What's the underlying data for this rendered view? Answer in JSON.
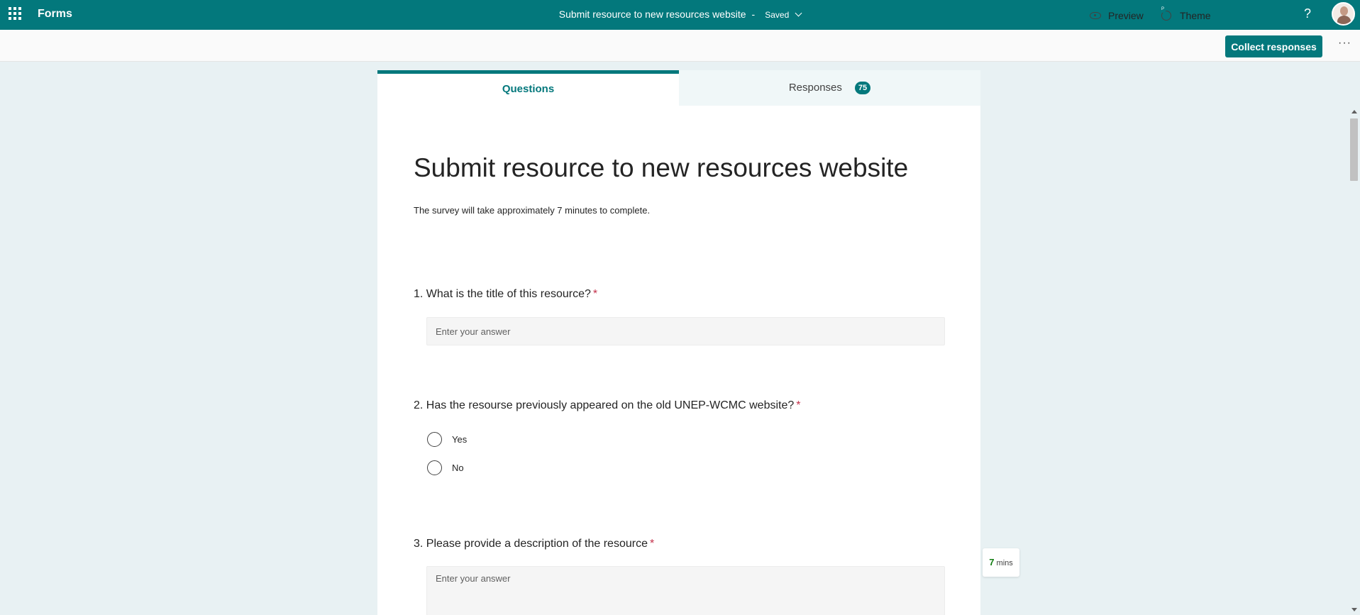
{
  "appbar": {
    "app_name": "Forms",
    "doc_title": "Submit resource to new resources website",
    "separator": "-",
    "save_state": "Saved",
    "help_label": "?"
  },
  "toolbar": {
    "preview_label": "Preview",
    "theme_label": "Theme",
    "theme_badge": "P",
    "collect_label": "Collect responses",
    "more_label": "···"
  },
  "tabs": [
    {
      "label": "Questions",
      "active": true
    },
    {
      "label": "Responses",
      "count": "75",
      "active": false
    }
  ],
  "form": {
    "title": "Submit resource to new resources website",
    "subtitle": "The survey will take approximately 7 minutes to complete.",
    "questions": [
      {
        "number": "1.",
        "text": "What is the title of this resource?",
        "required_mark": "*",
        "type": "text",
        "placeholder": "Enter your answer"
      },
      {
        "number": "2.",
        "text": "Has the resourse previously appeared on the old UNEP-WCMC website?",
        "required_mark": "*",
        "type": "choice",
        "options": [
          "Yes",
          "No"
        ]
      },
      {
        "number": "3.",
        "text": "Please provide a description of the resource",
        "required_mark": "*",
        "type": "longtext",
        "placeholder": "Enter your answer"
      }
    ]
  },
  "timer": {
    "value": "7",
    "unit": "mins"
  },
  "colors": {
    "brand": "#03787c",
    "required": "#c4314b",
    "canvas": "#e8f1f3"
  },
  "icons": [
    "app-launcher-icon",
    "help-icon",
    "preview-eye-icon",
    "theme-palette-icon",
    "chevron-down-icon",
    "more-icon",
    "radio-icon"
  ]
}
